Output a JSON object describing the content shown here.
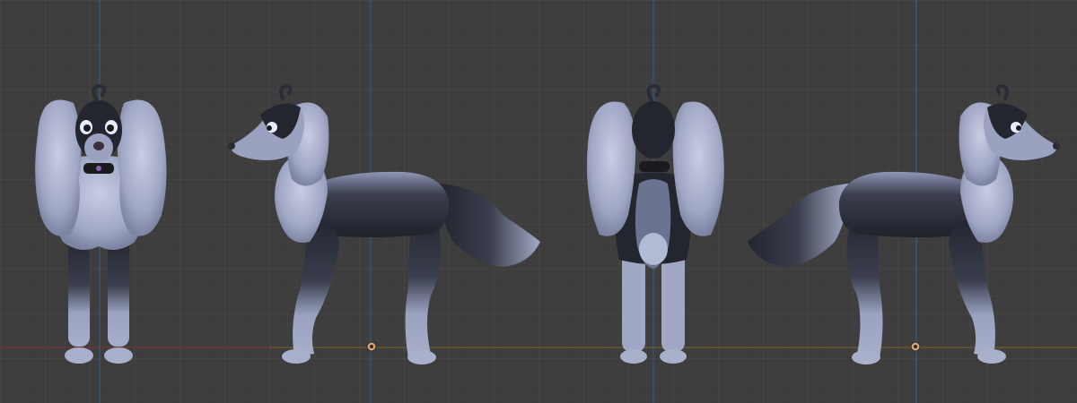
{
  "viewport": {
    "background": "#3d3d3d",
    "grid_minor_color": "#454545",
    "grid_major_color": "#4a4a4a",
    "x_axis_color": "#8a3b3b",
    "y_axis_color": "#5d7a34",
    "z_axis_color": "#3c5c8a",
    "panels": [
      "front",
      "left-side",
      "back",
      "right-side"
    ]
  },
  "model": {
    "fur_light": "#9aa2c0",
    "fur_mid": "#6c7390",
    "fur_dark": "#23262f",
    "collar": "#1b1b1f",
    "collar_gem": "#8a5db5",
    "eye": "#e8ecff"
  }
}
